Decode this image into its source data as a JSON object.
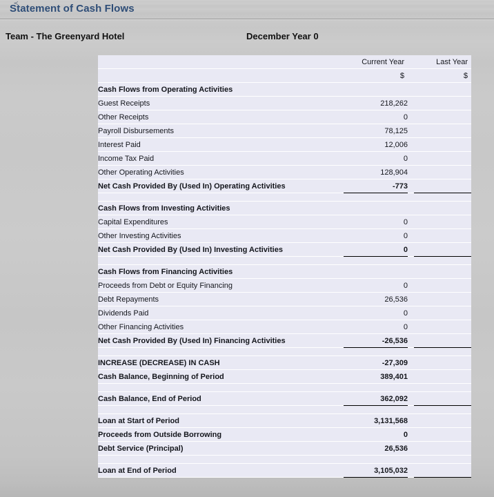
{
  "window": {
    "title": "Statement of Cash Flows",
    "corner_glyph": "≺"
  },
  "header": {
    "entity": "Team - The Greenyard Hotel",
    "period": "December  Year 0"
  },
  "table": {
    "columns": {
      "label": "",
      "current_year": "Current Year",
      "last_year": "Last Year",
      "currency_symbol_current": "$",
      "currency_symbol_last": "$"
    },
    "rows": [
      {
        "id": "operating-section",
        "kind": "section",
        "label": "Cash Flows from Operating Activities",
        "current": "",
        "last": ""
      },
      {
        "id": "guest-receipts",
        "kind": "item",
        "label": "Guest Receipts",
        "current": "218,262",
        "last": ""
      },
      {
        "id": "other-receipts",
        "kind": "item",
        "label": "Other Receipts",
        "current": "0",
        "last": ""
      },
      {
        "id": "payroll-disbursements",
        "kind": "item",
        "label": "Payroll Disbursements",
        "current": "78,125",
        "last": ""
      },
      {
        "id": "interest-paid",
        "kind": "item",
        "label": "Interest Paid",
        "current": "12,006",
        "last": ""
      },
      {
        "id": "income-tax-paid",
        "kind": "item",
        "label": "Income Tax Paid",
        "current": "0",
        "last": ""
      },
      {
        "id": "other-operating",
        "kind": "item",
        "label": "Other Operating Activities",
        "current": "128,904",
        "last": ""
      },
      {
        "id": "net-operating",
        "kind": "total",
        "label": "Net Cash Provided By (Used In) Operating Activities",
        "current": "-773",
        "last": ""
      },
      {
        "id": "spacer-1",
        "kind": "spacer",
        "label": "",
        "current": "",
        "last": ""
      },
      {
        "id": "investing-section",
        "kind": "section",
        "label": "Cash Flows from Investing Activities",
        "current": "",
        "last": ""
      },
      {
        "id": "capital-expenditures",
        "kind": "item2",
        "label": "Capital Expenditures",
        "current": "0",
        "last": ""
      },
      {
        "id": "other-investing",
        "kind": "item",
        "label": "Other Investing Activities",
        "current": "0",
        "last": ""
      },
      {
        "id": "net-investing",
        "kind": "total",
        "label": "Net Cash Provided By (Used In) Investing Activities",
        "current": "0",
        "last": ""
      },
      {
        "id": "spacer-2",
        "kind": "spacer",
        "label": "",
        "current": "",
        "last": ""
      },
      {
        "id": "financing-section",
        "kind": "section",
        "label": "Cash Flows from Financing Activities",
        "current": "",
        "last": ""
      },
      {
        "id": "proceeds-debt-equity",
        "kind": "item",
        "label": "Proceeds from Debt or Equity Financing",
        "current": "0",
        "last": ""
      },
      {
        "id": "debt-repayments",
        "kind": "item",
        "label": "Debt Repayments",
        "current": "26,536",
        "last": ""
      },
      {
        "id": "dividends-paid",
        "kind": "item",
        "label": "Dividends Paid",
        "current": "0",
        "last": ""
      },
      {
        "id": "other-financing",
        "kind": "item",
        "label": "Other Financing Activities",
        "current": "0",
        "last": ""
      },
      {
        "id": "net-financing",
        "kind": "total",
        "label": "Net Cash Provided By (Used In) Financing Activities",
        "current": "-26,536",
        "last": ""
      },
      {
        "id": "spacer-3",
        "kind": "spacer",
        "label": "",
        "current": "",
        "last": ""
      },
      {
        "id": "increase-decrease-cash",
        "kind": "strong",
        "label": "INCREASE (DECREASE) IN CASH",
        "current": "-27,309",
        "last": ""
      },
      {
        "id": "cash-balance-begin",
        "kind": "strong",
        "label": "Cash Balance, Beginning of Period",
        "current": "389,401",
        "last": ""
      },
      {
        "id": "spacer-4",
        "kind": "spacer",
        "label": "",
        "current": "",
        "last": ""
      },
      {
        "id": "cash-balance-end",
        "kind": "strongtotal",
        "label": "Cash Balance, End of Period",
        "current": "362,092",
        "last": ""
      },
      {
        "id": "spacer-5",
        "kind": "spacer",
        "label": "",
        "current": "",
        "last": ""
      },
      {
        "id": "loan-start",
        "kind": "strong",
        "label": "Loan at Start of Period",
        "current": "3,131,568",
        "last": ""
      },
      {
        "id": "proceeds-borrowing",
        "kind": "strong",
        "label": "Proceeds from Outside Borrowing",
        "current": "0",
        "last": ""
      },
      {
        "id": "debt-service-principal",
        "kind": "strong",
        "label": "Debt Service (Principal)",
        "current": "26,536",
        "last": ""
      },
      {
        "id": "spacer-6",
        "kind": "spacer",
        "label": "",
        "current": "",
        "last": ""
      },
      {
        "id": "loan-end",
        "kind": "strongtotal",
        "label": "Loan at End of Period",
        "current": "3,105,032",
        "last": ""
      }
    ]
  }
}
